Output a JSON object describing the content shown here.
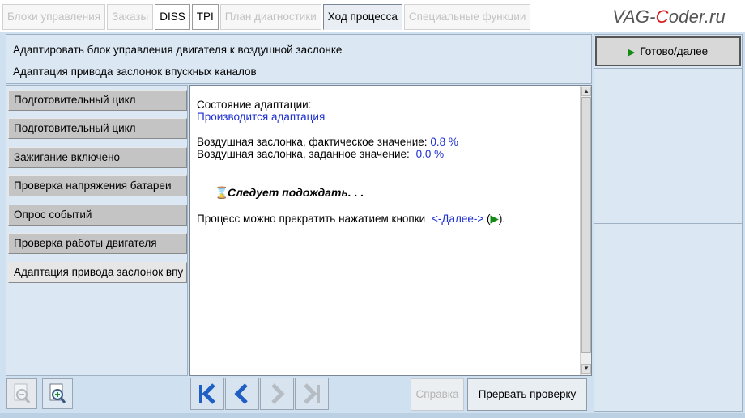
{
  "tabs": [
    {
      "label": "Блоки управления",
      "state": "disabled"
    },
    {
      "label": "Заказы",
      "state": "disabled"
    },
    {
      "label": "DISS",
      "state": "active"
    },
    {
      "label": "TPI",
      "state": "active"
    },
    {
      "label": "План диагностики",
      "state": "disabled"
    },
    {
      "label": "Ход процесса",
      "state": "current"
    },
    {
      "label": "Специальные функции",
      "state": "disabled"
    }
  ],
  "brand": {
    "prefix": "VAG-",
    "highlight": "C",
    "suffix": "oder.ru"
  },
  "header": {
    "line1": "Адаптировать блок управления двигателя к воздушной заслонке",
    "line2": "Адаптация привода заслонок впускных каналов"
  },
  "steps": [
    "Подготовительный цикл",
    "Подготовительный цикл",
    "Зажигание включено",
    "Проверка напряжения батареи",
    "Опрос событий",
    "Проверка работы двигателя",
    "Адаптация привода заслонок впу"
  ],
  "content": {
    "status_label": "Состояние адаптации:",
    "status_value": "Производится адаптация",
    "actual_label": "Воздушная заслонка, фактическое значение:",
    "actual_value": "0.8 %",
    "target_label": "Воздушная заслонка, заданное значение:",
    "target_value": "0.0 %",
    "wait_text": "Следует подождать. . .",
    "stop_text": "Процесс можно прекратить нажатием кнопки",
    "next_key": "<-Далее->",
    "paren_open": "(",
    "paren_close": ")."
  },
  "right": {
    "ready_label": "Готово/далее"
  },
  "buttons": {
    "help": "Справка",
    "abort": "Прервать проверку"
  },
  "icons": {
    "zoom_out": "zoom-out-icon",
    "zoom_in": "zoom-in-icon",
    "first": "skip-to-first-icon",
    "prev": "previous-icon",
    "next": "next-icon",
    "last": "skip-to-last-icon"
  },
  "colors": {
    "accent_blue": "#1d2fd0",
    "play_green": "#138a13",
    "background": "#cfe0f1"
  }
}
